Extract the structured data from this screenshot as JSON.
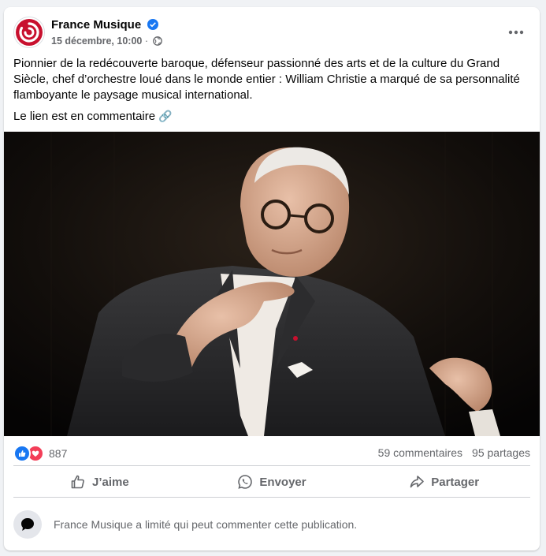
{
  "post": {
    "page_name": "France Musique",
    "timestamp": "15 décembre, 10:00",
    "separator": "·",
    "visibility_icon": "globe-icon",
    "verified_icon": "verified-badge-icon",
    "more_icon": "more-options-icon",
    "text_paragraph_1": "Pionnier de la redécouverte baroque, défenseur passionné des arts et de la culture du Grand Siècle, chef d’orchestre loué dans le monde entier : William Christie a marqué de sa personnalité flamboyante le paysage musical international.",
    "text_paragraph_2": "Le lien est en commentaire",
    "link_emoji": "🔗",
    "image_icon": "conductor-photo"
  },
  "stats": {
    "reactions": [
      "like",
      "love"
    ],
    "reaction_count": "887",
    "comments": "59 commentaires",
    "shares": "95 partages"
  },
  "actions": {
    "like_label": "J’aime",
    "send_label": "Envoyer",
    "share_label": "Partager"
  },
  "comments_notice": "France Musique a limité qui peut commenter cette publication.",
  "colors": {
    "brand": "#c8102e",
    "like_blue": "#1877f2",
    "love_red": "#f33e58",
    "secondary_text": "#65676b"
  }
}
